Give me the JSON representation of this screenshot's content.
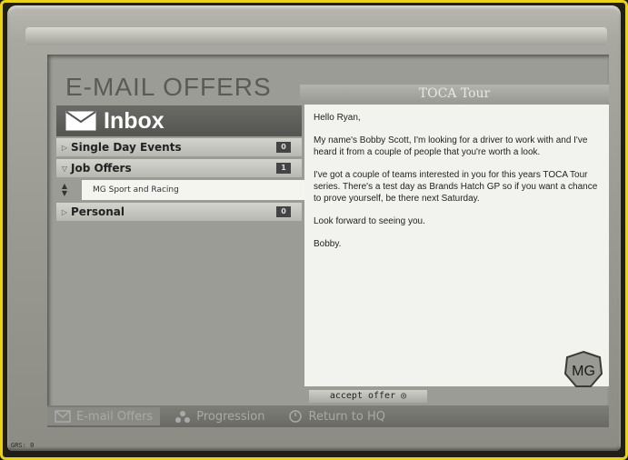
{
  "title": "E-MAIL OFFERS",
  "sender": "TOCA Tour",
  "inbox_label": "Inbox",
  "folders": [
    {
      "label": "Single Day Events",
      "count": "0",
      "arrow": "▷"
    },
    {
      "label": "Job Offers",
      "count": "1",
      "arrow": "▽"
    },
    {
      "label": "Personal",
      "count": "0",
      "arrow": "▷"
    }
  ],
  "job_offer_item": "MG Sport and Racing",
  "message": {
    "greeting": "Hello Ryan,",
    "p1": "My name's Bobby Scott, I'm looking for a driver to work with and I've heard it from a couple of people that you're worth a look.",
    "p2": "I've got a couple of teams interested in you for this years TOCA Tour series. There's a test day as Brands Hatch GP so if you want a chance to prove yourself, be there next Saturday.",
    "p3": "Look forward to seeing you.",
    "signoff": "Bobby."
  },
  "accept_label": "accept offer ◎",
  "nav": {
    "email": "E-mail Offers",
    "progression": "Progression",
    "return": "Return to HQ"
  },
  "status": "GRS: 0",
  "colors": {
    "frame": "#e8d21a",
    "bezel": "#a8a8a0",
    "screen": "#9c9c96",
    "panel": "#f2f2ee"
  },
  "icons": [
    "envelope-icon",
    "mg-logo",
    "progression-icon",
    "clock-icon"
  ]
}
